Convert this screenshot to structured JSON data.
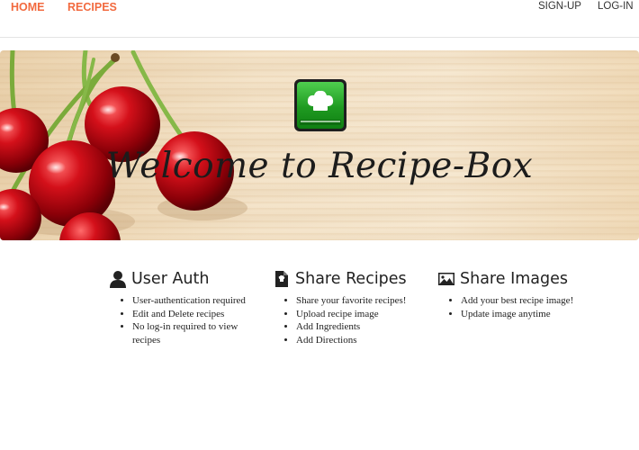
{
  "nav": {
    "home_label": "HOME",
    "recipes_label": "RECIPES",
    "signup_label": "SIGN-UP",
    "login_label": "LOG-IN"
  },
  "hero": {
    "title": "Welcome to Recipe-Box",
    "logo_icon": "chef-hat-book-icon",
    "decor_image": "cherries-image"
  },
  "features": [
    {
      "icon": "user-icon",
      "title": "User Auth",
      "items": [
        "User-authentication required",
        "Edit and Delete recipes",
        "No log-in required to view recipes"
      ]
    },
    {
      "icon": "recipe-document-icon",
      "title": "Share Recipes",
      "items": [
        "Share your favorite recipes!",
        "Upload recipe image",
        "Add Ingredients",
        "Add Directions"
      ]
    },
    {
      "icon": "image-icon",
      "title": "Share Images",
      "items": [
        "Add your best recipe image!",
        "Update image anytime"
      ]
    }
  ],
  "colors": {
    "accent": "#f26a3f",
    "nav_text": "#333333",
    "logo_green": "#1f9a21",
    "text": "#222222"
  }
}
